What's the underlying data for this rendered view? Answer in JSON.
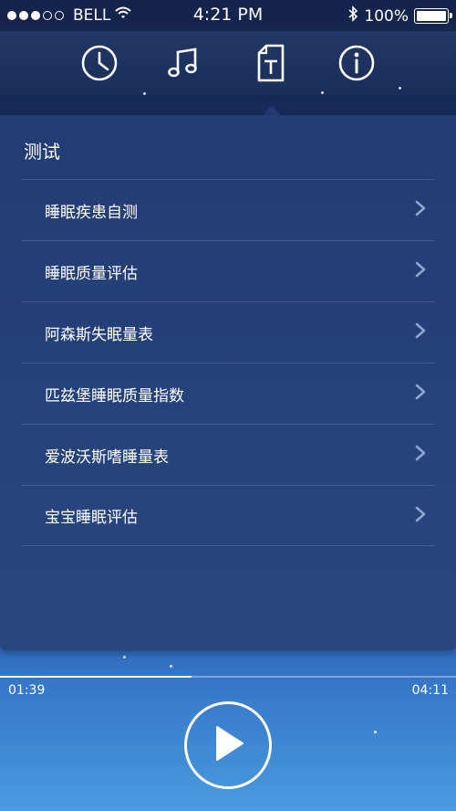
{
  "status_bar": {
    "carrier": "BELL",
    "time": "4:21 PM",
    "battery": "100%",
    "battery_level": 1.0
  },
  "nav": {
    "icons": [
      "clock-icon",
      "music-note-icon",
      "test-document-icon",
      "info-icon"
    ],
    "active": "test-document-icon"
  },
  "panel": {
    "title": "测试",
    "items": [
      {
        "label": "睡眠疾患自测"
      },
      {
        "label": "睡眠质量评估"
      },
      {
        "label": "阿森斯失眠量表"
      },
      {
        "label": "匹兹堡睡眠质量指数"
      },
      {
        "label": "爱波沃斯嗜睡量表"
      },
      {
        "label": "宝宝睡眠评估"
      }
    ]
  },
  "player": {
    "elapsed": "01:39",
    "total": "04:11",
    "progress": 0.42
  },
  "colors": {
    "panel": "#233c73",
    "background_bottom": "#4a9ae0"
  }
}
